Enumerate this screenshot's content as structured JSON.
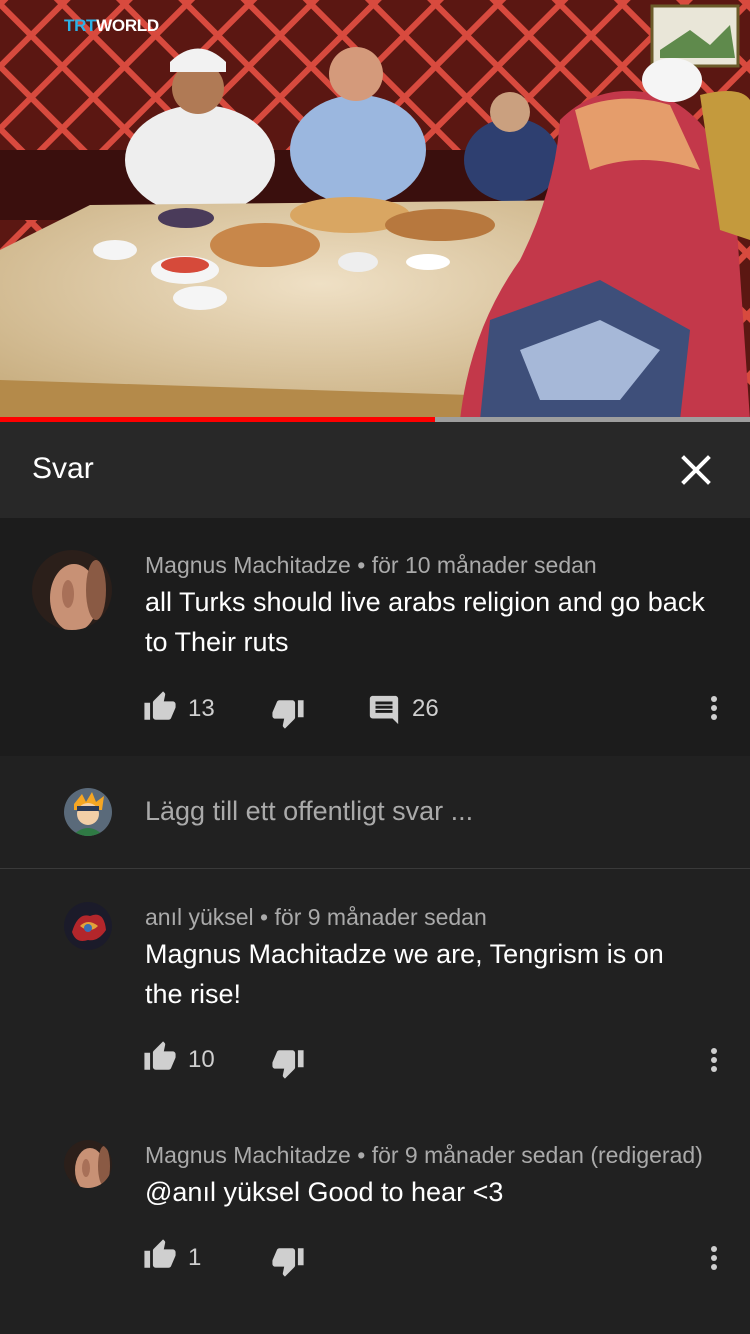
{
  "video": {
    "watermark_prefix": "TRT",
    "watermark_suffix": "WORLD",
    "progress_fraction": 0.58
  },
  "header": {
    "title": "Svar",
    "close_icon": "close-icon"
  },
  "parent_comment": {
    "author": "Magnus Machitadze",
    "time": "för 10 månader sedan",
    "text": "all Turks should live arabs religion and go back to Their ruts",
    "likes": "13",
    "replies": "26"
  },
  "reply_box": {
    "placeholder": "Lägg till ett offentligt svar ..."
  },
  "replies": [
    {
      "author": "anıl yüksel",
      "time": "för 9 månader sedan",
      "text": "Magnus Machitadze we are, Tengrism is on the rise!",
      "likes": "10"
    },
    {
      "author": "Magnus Machitadze",
      "time": "för 9 månader sedan (redigerad)",
      "text": "@anıl yüksel Good to hear <3",
      "likes": "1"
    }
  ],
  "colors": {
    "background": "#212121",
    "progress": "#ff0000",
    "muted_text": "#aaaaaa"
  }
}
